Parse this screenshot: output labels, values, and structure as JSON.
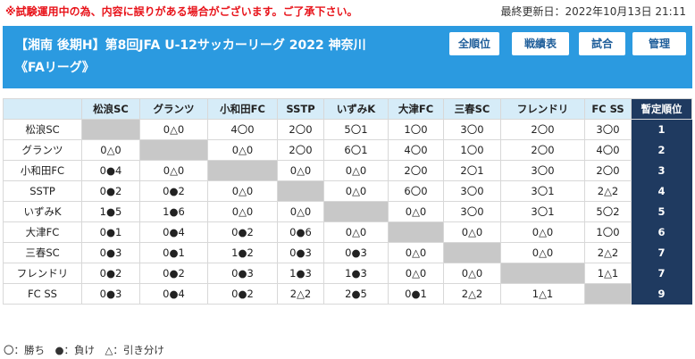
{
  "notice": "※試験運用中の為、内容に誤りがある場合がございます。ご了承下さい。",
  "last_updated": "最終更新日：2022年10月13日 21:11",
  "header": {
    "title_line1": "【湘南 後期H】第8回JFA U-12サッカーリーグ 2022 神奈川",
    "title_line2": "《FAリーグ》",
    "buttons": [
      "全順位",
      "戦績表",
      "試合",
      "管理"
    ]
  },
  "table": {
    "columns": [
      "松浪SC",
      "グランツ",
      "小和田FC",
      "SSTP",
      "いずみK",
      "大津FC",
      "三春SC",
      "フレンドリ",
      "FC SS"
    ],
    "rank_header": "暫定順位",
    "rows": [
      {
        "team": "松浪SC",
        "results": [
          "",
          "0△0",
          "4〇0",
          "2〇0",
          "5〇1",
          "1〇0",
          "3〇0",
          "2〇0",
          "3〇0"
        ],
        "rank": "1"
      },
      {
        "team": "グランツ",
        "results": [
          "0△0",
          "",
          "0△0",
          "2〇0",
          "6〇1",
          "4〇0",
          "1〇0",
          "2〇0",
          "4〇0"
        ],
        "rank": "2"
      },
      {
        "team": "小和田FC",
        "results": [
          "0●4",
          "0△0",
          "",
          "0△0",
          "0△0",
          "2〇0",
          "2〇1",
          "3〇0",
          "2〇0"
        ],
        "rank": "3"
      },
      {
        "team": "SSTP",
        "results": [
          "0●2",
          "0●2",
          "0△0",
          "",
          "0△0",
          "6〇0",
          "3〇0",
          "3〇1",
          "2△2"
        ],
        "rank": "4"
      },
      {
        "team": "いずみK",
        "results": [
          "1●5",
          "1●6",
          "0△0",
          "0△0",
          "",
          "0△0",
          "3〇0",
          "3〇1",
          "5〇2"
        ],
        "rank": "5"
      },
      {
        "team": "大津FC",
        "results": [
          "0●1",
          "0●4",
          "0●2",
          "0●6",
          "0△0",
          "",
          "0△0",
          "0△0",
          "1〇0"
        ],
        "rank": "6"
      },
      {
        "team": "三春SC",
        "results": [
          "0●3",
          "0●1",
          "1●2",
          "0●3",
          "0●3",
          "0△0",
          "",
          "0△0",
          "2△2"
        ],
        "rank": "7"
      },
      {
        "team": "フレンドリ",
        "results": [
          "0●2",
          "0●2",
          "0●3",
          "1●3",
          "1●3",
          "0△0",
          "0△0",
          "",
          "1△1"
        ],
        "rank": "7"
      },
      {
        "team": "FC SS",
        "results": [
          "0●3",
          "0●4",
          "0●2",
          "2△2",
          "2●5",
          "0●1",
          "2△2",
          "1△1",
          ""
        ],
        "rank": "9"
      }
    ]
  },
  "legend": "〇：勝ち　●：負け　△：引き分け",
  "colors": {
    "header_bg": "#2b9ae0",
    "rank_bg": "#1f3a60",
    "notice": "#e8141b",
    "col_header_bg": "#d6ecf8",
    "self_cell": "#c8c8c8"
  }
}
